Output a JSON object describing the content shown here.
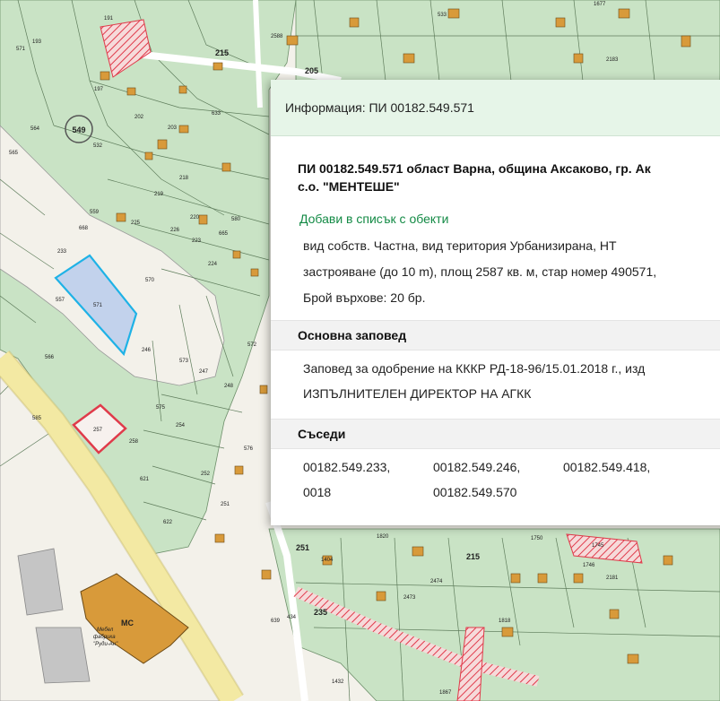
{
  "panel": {
    "header_title": "Информация: ПИ 00182.549.571",
    "title_line1": "ПИ 00182.549.571 област Варна, община Аксаково, гр. Ак",
    "title_line2": "с.о. \"МЕНТЕШЕ\"",
    "add_link": "Добави в списък с обекти",
    "desc_line1": "вид собств. Частна, вид територия Урбанизирана, НТ",
    "desc_line2": "застрояване (до 10 m), площ 2587 кв. м, стар номер 490571, ",
    "desc_line3": "Брой върхове: 20 бр.",
    "order_heading": "Основна заповед",
    "order_line1": "Заповед за одобрение на КККР РД-18-96/15.01.2018 г., изд",
    "order_line2": "ИЗПЪЛНИТЕЛЕН ДИРЕКТОР НА АГКК",
    "neighbors_heading": "Съседи",
    "neighbors": [
      "00182.549.233,",
      "00182.549.246,",
      "00182.549.418,",
      "0018",
      "00182.549.570"
    ]
  },
  "map": {
    "block_label": "549",
    "selected_parcel": "571",
    "highlighted_parcel": "257",
    "building_label": "МС",
    "factory_label_line1": "Мебел",
    "factory_label_line2": "фабрика",
    "factory_label_line3": "\"Руди-Ан\"",
    "road_labels": [
      "215",
      "205",
      "251",
      "215",
      "235"
    ],
    "parcel_numbers": [
      {
        "t": "191"
      },
      {
        "t": "193"
      },
      {
        "t": "197"
      },
      {
        "t": "202"
      },
      {
        "t": "203"
      },
      {
        "t": "532"
      },
      {
        "t": "218"
      },
      {
        "t": "219"
      },
      {
        "t": "225"
      },
      {
        "t": "226"
      },
      {
        "t": "665"
      },
      {
        "t": "224"
      },
      {
        "t": "220"
      },
      {
        "t": "223"
      },
      {
        "t": "668"
      },
      {
        "t": "559"
      },
      {
        "t": "233"
      },
      {
        "t": "557"
      },
      {
        "t": "566"
      },
      {
        "t": "564"
      },
      {
        "t": "565"
      },
      {
        "t": "570"
      },
      {
        "t": "246"
      },
      {
        "t": "573"
      },
      {
        "t": "247"
      },
      {
        "t": "575"
      },
      {
        "t": "254"
      },
      {
        "t": "248"
      },
      {
        "t": "258"
      },
      {
        "t": "621"
      },
      {
        "t": "252"
      },
      {
        "t": "622"
      },
      {
        "t": "251"
      },
      {
        "t": "576"
      },
      {
        "t": "585"
      },
      {
        "t": "571"
      },
      {
        "t": "633"
      },
      {
        "t": "580"
      },
      {
        "t": "2588"
      },
      {
        "t": "533"
      },
      {
        "t": "1677"
      },
      {
        "t": "2183"
      },
      {
        "t": "1820"
      },
      {
        "t": "1404"
      },
      {
        "t": "1750"
      },
      {
        "t": "1745"
      },
      {
        "t": "1746"
      },
      {
        "t": "2181"
      },
      {
        "t": "2474"
      },
      {
        "t": "2473"
      },
      {
        "t": "1818"
      },
      {
        "t": "1867"
      },
      {
        "t": "1432"
      },
      {
        "t": "434"
      },
      {
        "t": "639"
      },
      {
        "t": "572"
      }
    ]
  },
  "colors": {
    "parcel_green": "#c9e3c5",
    "parcel_line": "#6d8f6a",
    "selected_fill": "#b8cdec",
    "selected_stroke": "#1eb2e6",
    "highlight_red": "#e03a4a",
    "building": "#d89a3a",
    "road_yellow": "#f3e9a3",
    "panel_header": "#e6f5e8",
    "link_green": "#138a45"
  }
}
